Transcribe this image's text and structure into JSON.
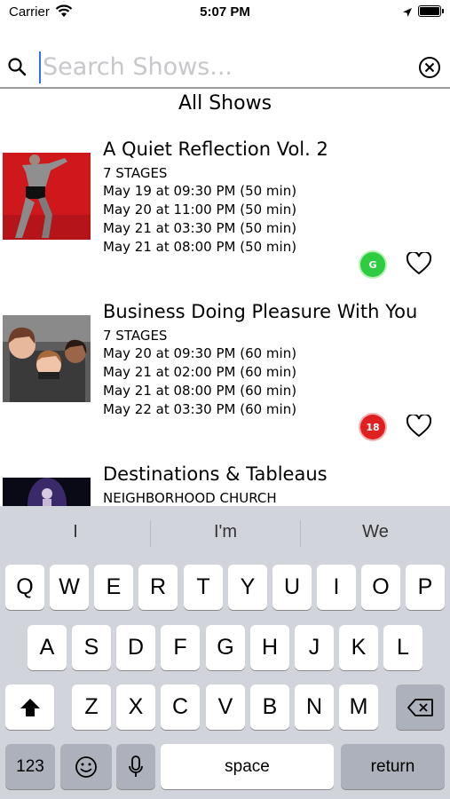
{
  "status_bar": {
    "carrier": "Carrier",
    "time": "5:07 PM"
  },
  "search": {
    "placeholder": "Search Shows...",
    "value": ""
  },
  "section_title": "All Shows",
  "shows": [
    {
      "title": "A Quiet Reflection Vol. 2",
      "venue": "7 STAGES",
      "times": [
        "May 19 at 09:30 PM (50 min)",
        "May 20 at 11:00 PM (50 min)",
        "May 21 at 03:30 PM (50 min)",
        "May 21 at 08:00 PM (50 min)"
      ],
      "rating": "G",
      "rating_color": "#2ecc40"
    },
    {
      "title": "Business Doing Pleasure With You",
      "venue": "7 STAGES",
      "times": [
        "May 20 at 09:30 PM (60 min)",
        "May 21 at 02:00 PM (60 min)",
        "May 21 at 08:00 PM (60 min)",
        "May 22 at 03:30 PM (60 min)"
      ],
      "rating": "18",
      "rating_color": "#e02020"
    },
    {
      "title": "Destinations & Tableaus",
      "venue": "NEIGHBORHOOD CHURCH"
    }
  ],
  "keyboard": {
    "suggestions": [
      "I",
      "I'm",
      "We"
    ],
    "row1": [
      "Q",
      "W",
      "E",
      "R",
      "T",
      "Y",
      "U",
      "I",
      "O",
      "P"
    ],
    "row2": [
      "A",
      "S",
      "D",
      "F",
      "G",
      "H",
      "J",
      "K",
      "L"
    ],
    "row3": [
      "Z",
      "X",
      "C",
      "V",
      "B",
      "N",
      "M"
    ],
    "numbers_label": "123",
    "space_label": "space",
    "return_label": "return"
  },
  "icons": [
    "wifi-icon",
    "location-arrow-icon",
    "battery-icon",
    "search-icon",
    "clear-icon",
    "heart-icon",
    "shift-icon",
    "delete-icon",
    "emoji-icon",
    "microphone-icon"
  ]
}
